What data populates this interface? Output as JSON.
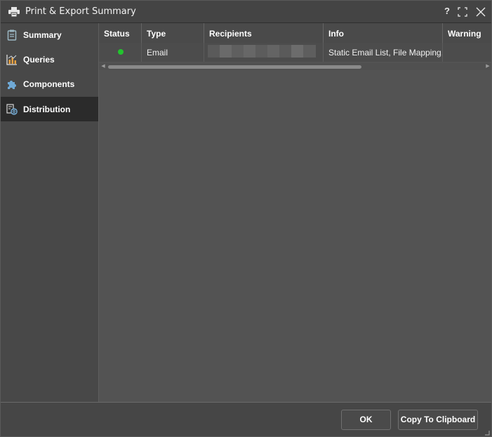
{
  "window": {
    "title": "Print & Export Summary",
    "help_label": "?"
  },
  "sidebar": {
    "items": [
      {
        "label": "Summary",
        "icon": "clipboard-icon",
        "active": false
      },
      {
        "label": "Queries",
        "icon": "bar-chart-icon",
        "active": false
      },
      {
        "label": "Components",
        "icon": "puzzle-icon",
        "active": false
      },
      {
        "label": "Distribution",
        "icon": "distribution-icon",
        "active": true
      }
    ]
  },
  "grid": {
    "columns": [
      "Status",
      "Type",
      "Recipients",
      "Info",
      "Warning"
    ],
    "rows": [
      {
        "status": "ok",
        "status_color": "#22c42e",
        "type": "Email",
        "recipients": "",
        "info": "Static Email List, File Mapping,",
        "warning": ""
      }
    ]
  },
  "footer": {
    "ok_label": "OK",
    "copy_label": "Copy To Clipboard"
  },
  "colors": {
    "background": "#444444",
    "active_nav": "#2b2b2b",
    "grid_bg": "#535353",
    "status_ok": "#22c42e"
  }
}
